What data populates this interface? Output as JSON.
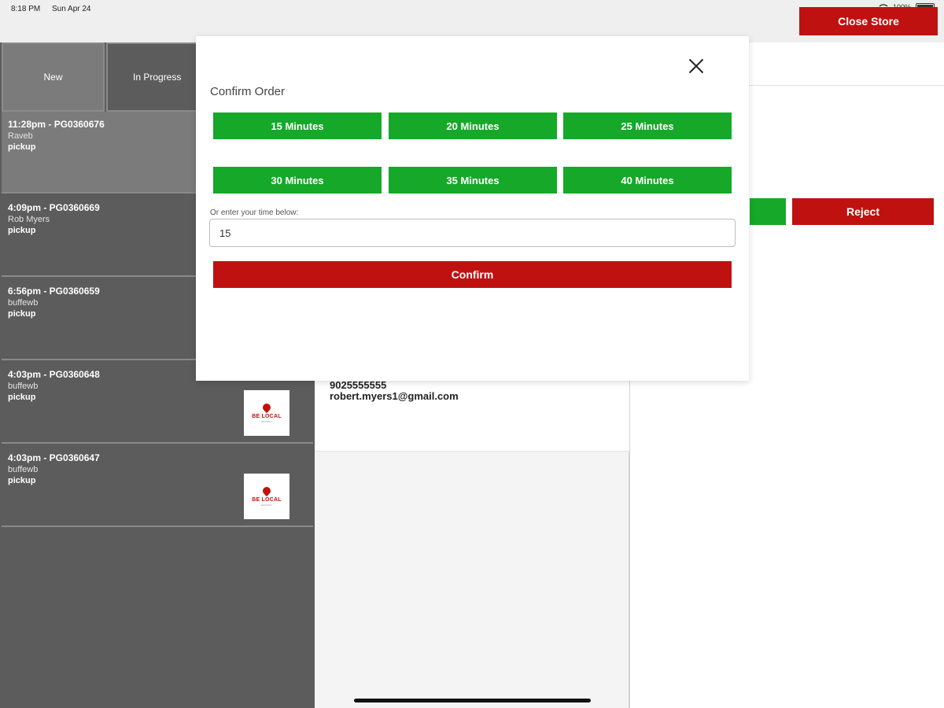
{
  "status_bar": {
    "time": "8:18 PM",
    "date": "Sun Apr 24",
    "battery": "100%"
  },
  "header": {
    "close_store_label": "Close Store"
  },
  "tabs": [
    {
      "label": "New"
    },
    {
      "label": "In Progress"
    }
  ],
  "orders": [
    {
      "title": "11:28pm - PG0360676",
      "name": "Raveb",
      "type": "pickup"
    },
    {
      "title": "4:09pm - PG0360669",
      "name": "Rob Myers",
      "type": "pickup"
    },
    {
      "title": "6:56pm - PG0360659",
      "name": "buffewb",
      "type": "pickup"
    },
    {
      "title": "4:03pm - PG0360648",
      "name": "buffewb",
      "type": "pickup"
    },
    {
      "title": "4:03pm - PG0360647",
      "name": "buffewb",
      "type": "pickup"
    }
  ],
  "logo": {
    "text": "BE LOCAL",
    "subtext": "DELIVERY"
  },
  "customer": {
    "phone": "9025555555",
    "email": "robert.myers1@gmail.com"
  },
  "right_panel": {
    "reject_label": "Reject"
  },
  "modal": {
    "title": "Confirm Order",
    "time_options": [
      {
        "label": "15 Minutes"
      },
      {
        "label": "20 Minutes"
      },
      {
        "label": "25 Minutes"
      },
      {
        "label": "30 Minutes"
      },
      {
        "label": "35 Minutes"
      },
      {
        "label": "40 Minutes"
      }
    ],
    "input_label": "Or enter your time below:",
    "input_value": "15",
    "confirm_label": "Confirm"
  },
  "colors": {
    "accent_red": "#c01111",
    "accent_green": "#16a829",
    "list_bg": "#5c5c5c"
  }
}
